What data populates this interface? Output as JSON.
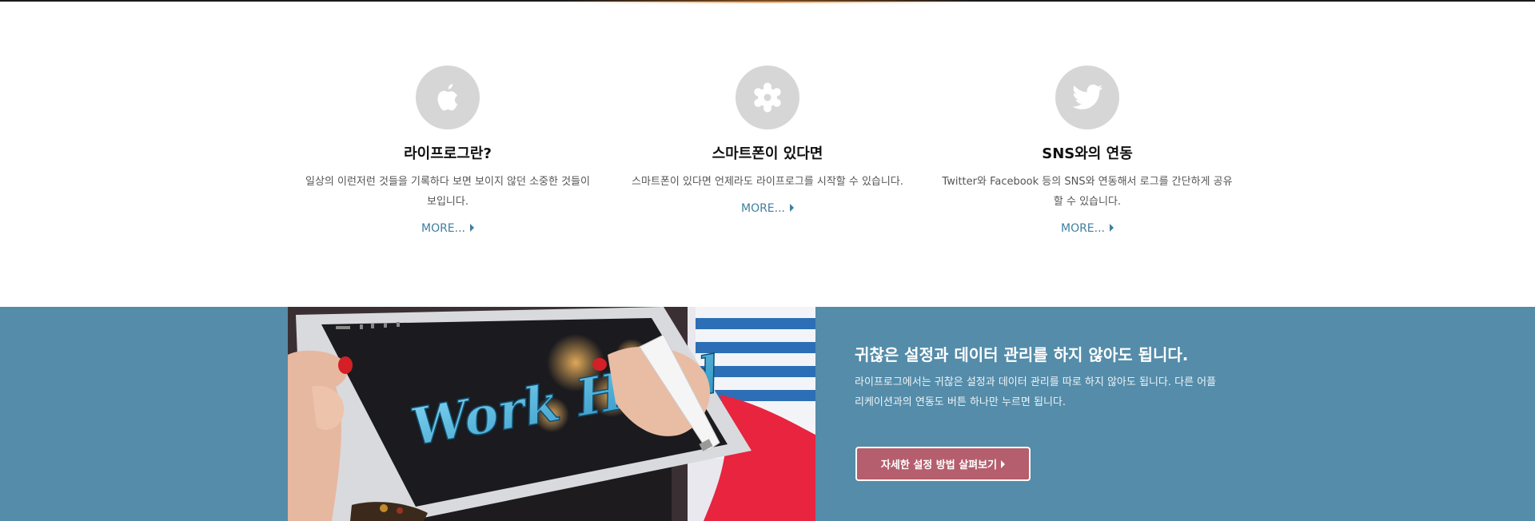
{
  "features": [
    {
      "icon": "apple-icon",
      "title": "라이프로그란?",
      "description": "일상의 이런저런 것들을 기록하다 보면 보이지 않던 소중한 것들이 보입니다.",
      "more_label": "MORE..."
    },
    {
      "icon": "gear-icon",
      "title": "스마트폰이 있다면",
      "description": "스마트폰이 있다면 언제라도 라이프로그를 시작할 수 있습니다.",
      "more_label": "MORE..."
    },
    {
      "icon": "twitter-icon",
      "title": "SNS와의 연동",
      "description": "Twitter와 Facebook 등의 SNS와 연동해서 로그를 간단하게 공유할 수 있습니다.",
      "more_label": "MORE..."
    }
  ],
  "promo": {
    "title": "귀찮은 설정과 데이터 관리를 하지 않아도 됩니다.",
    "description": "라이프로그에서는 귀찮은 설정과 데이터 관리를 따로 하지 않아도 됩니다. 다른 어플리케이션과의 연동도 버튼 하나만 누르면 됩니다.",
    "button_label": "자세한 설정 방법 살펴보기"
  },
  "photo": {
    "screen_text": "Work Hard"
  },
  "colors": {
    "band_bg": "#548ca9",
    "link": "#3f7f9f",
    "button_bg": "#b55e6d",
    "icon_circle": "#d6d6d6"
  }
}
